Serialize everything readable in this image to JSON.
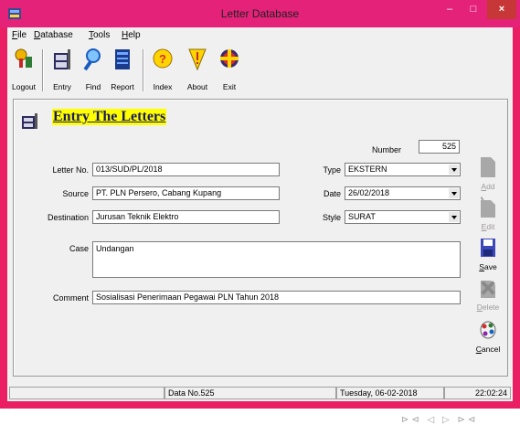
{
  "window": {
    "title": "Letter Database",
    "controls": {
      "minimize": "–",
      "maximize": "□",
      "close": "×"
    }
  },
  "menu": [
    {
      "label": "File",
      "accel": "F",
      "rest": "ile"
    },
    {
      "label": "Database",
      "accel": "D",
      "rest": "atabase"
    },
    {
      "label": "Tools",
      "accel": "T",
      "rest": "ools"
    },
    {
      "label": "Help",
      "accel": "H",
      "rest": "elp"
    }
  ],
  "toolbar": [
    {
      "label": "Logout",
      "icon": "logout-keys-icon"
    },
    {
      "label": "Entry",
      "icon": "entry-cabinet-icon"
    },
    {
      "label": "Find",
      "icon": "find-magnifier-icon"
    },
    {
      "label": "Report",
      "icon": "report-book-icon"
    },
    {
      "label": "Index",
      "icon": "index-help-icon"
    },
    {
      "label": "About",
      "icon": "about-exclaim-icon"
    },
    {
      "label": "Exit",
      "icon": "exit-cross-icon"
    }
  ],
  "form": {
    "title": "Entry The Letters",
    "number_label": "Number",
    "number_value": "525",
    "letter_no_label": "Letter No.",
    "letter_no_value": "013/SUD/PL/2018",
    "source_label": "Source",
    "source_value": "PT. PLN Persero, Cabang Kupang",
    "destination_label": "Destination",
    "destination_value": "Jurusan Teknik Elektro",
    "type_label": "Type",
    "type_value": "EKSTERN",
    "date_label": "Date",
    "date_value": "26/02/2018",
    "style_label": "Style",
    "style_value": "SURAT",
    "case_label": "Case",
    "case_value": "Undangan",
    "comment_label": "Comment",
    "comment_value": "Sosialisasi Penerimaan Pegawai PLN Tahun 2018"
  },
  "actions": [
    {
      "label": "Add",
      "accel": "A",
      "rest": "dd",
      "enabled": false
    },
    {
      "label": "Edit",
      "accel": "E",
      "rest": "dit",
      "enabled": false
    },
    {
      "label": "Save",
      "accel": "S",
      "rest": "ave",
      "enabled": true
    },
    {
      "label": "Delete",
      "accel": "D",
      "rest": "elete",
      "enabled": false
    },
    {
      "label": "Cancel",
      "accel": "C",
      "rest": "ancel",
      "enabled": true
    }
  ],
  "navigation": {
    "first": "⊳⊲",
    "prev": "◁",
    "next": "▷",
    "last": "⊳⊲"
  },
  "status": {
    "data": "Data No.525",
    "date": "Tuesday, 06-02-2018",
    "time": "22:02:24"
  }
}
